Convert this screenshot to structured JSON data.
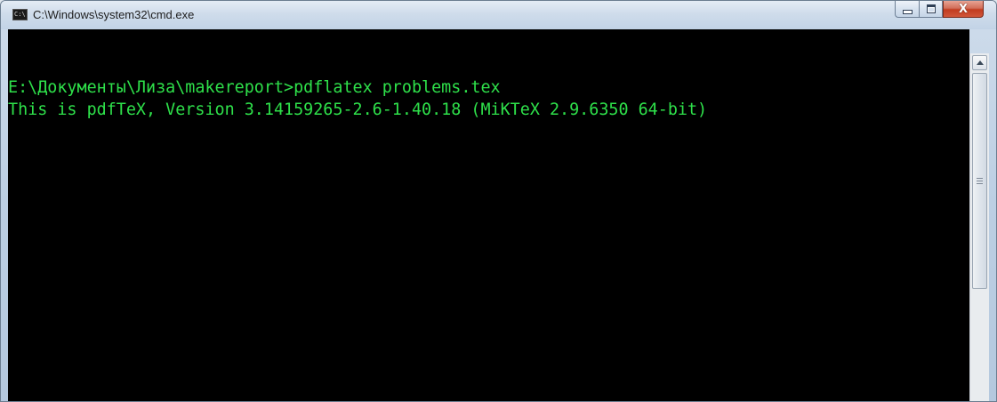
{
  "window": {
    "title": "C:\\Windows\\system32\\cmd.exe",
    "app_icon_label": "C:\\"
  },
  "caption_buttons": {
    "close_glyph": "X"
  },
  "console": {
    "text_color": "#2ee04a",
    "background": "#000000",
    "lines": [
      "E:\\Документы\\Лиза\\makereport>pdflatex problems.tex",
      "This is pdfTeX, Version 3.14159265-2.6-1.40.18 (MiKTeX 2.9.6350 64-bit)"
    ]
  },
  "icons": {
    "app": "cmd-icon",
    "minimize": "minimize-icon",
    "maximize": "maximize-icon",
    "close": "close-icon",
    "scroll_up": "arrow-up-icon",
    "grip": "grip-icon"
  }
}
